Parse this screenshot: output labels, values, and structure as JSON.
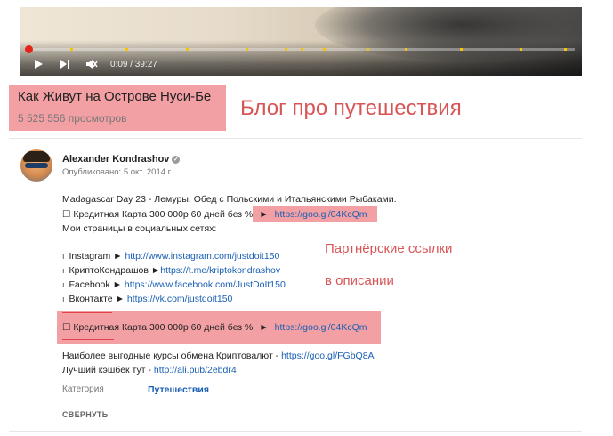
{
  "player": {
    "time": "0:09 / 39:27",
    "progress": 0.004,
    "ad_markers": [
      0.08,
      0.18,
      0.29,
      0.4,
      0.47,
      0.5,
      0.54,
      0.62,
      0.69,
      0.79,
      0.9,
      0.98
    ],
    "play_icon": "play-icon",
    "next_icon": "next-icon",
    "mute_icon": "volume-muted-icon"
  },
  "video": {
    "title": "Как Живут на Острове Нуси-Бе",
    "views": "5 525 556 просмотров"
  },
  "annotations": {
    "blog": "Блог про путешествия",
    "partner_1": "Партнёрские ссылки",
    "partner_2": "в описании"
  },
  "channel": {
    "name": "Alexander Kondrashov",
    "published": "Опубликовано: 5 окт. 2014 г.",
    "verified_icon": "verified-icon"
  },
  "description": {
    "line1": "Madagascar Day 23 - Лемуры. Обед с Польскими и Итальянскими Рыбаками.",
    "card1_text": "☐ Кредитная Карта 300 000р 60 дней без %",
    "card1_arrow": "►",
    "card1_link": "https://goo.gl/04KcQm",
    "social_heading": "Мои страницы в социальных сетях:",
    "social": [
      {
        "name": "Instagram",
        "arrow": "►",
        "url": "http://www.instagram.com/justdoit150"
      },
      {
        "name": "КриптоКондрашов",
        "arrow": "►",
        "url": "https://t.me/kriptokondrashov"
      },
      {
        "name": "Facebook",
        "arrow": "►",
        "url": "https://www.facebook.com/JustDoIt150"
      },
      {
        "name": "Вконтакте",
        "arrow": "►",
        "url": "https://vk.com/justdoit150"
      }
    ],
    "card2_text": "☐ Кредитная Карта 300 000р 60 дней без %",
    "card2_arrow": "►",
    "card2_link": "https://goo.gl/04KcQm",
    "crypto_text": "Наиболее выгодные курсы обмена Криптовалют -",
    "crypto_link": "https://goo.gl/FGbQ8A",
    "cashback_text": "Лучший кэшбек тут -",
    "cashback_link": "http://ali.pub/2ebdr4"
  },
  "meta": {
    "category_label": "Категория",
    "category_value": "Путешествия",
    "collapse": "СВЕРНУТЬ"
  },
  "colors": {
    "highlight": "#f2a0a4",
    "annotation": "#d85556",
    "link": "#1a5fb4",
    "progress": "#e62117",
    "marker": "#f7c500"
  }
}
